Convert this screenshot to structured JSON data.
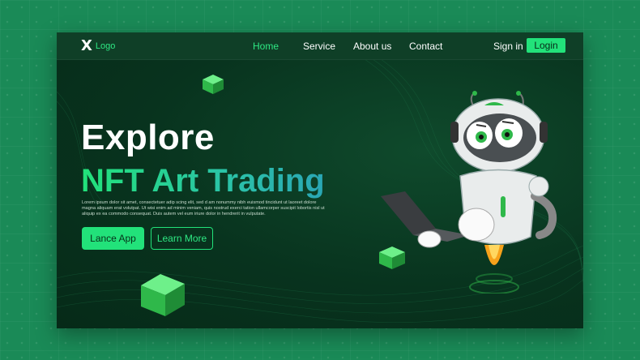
{
  "brand": {
    "logo_mark": "X",
    "logo_text": "Logo"
  },
  "nav": {
    "items": [
      {
        "label": "Home",
        "active": true
      },
      {
        "label": "Service",
        "active": false
      },
      {
        "label": "About us",
        "active": false
      },
      {
        "label": "Contact",
        "active": false
      }
    ],
    "signin_label": "Sign in",
    "login_label": "Login"
  },
  "hero": {
    "title_line1": "Explore",
    "title_line2": "NFT Art Trading",
    "description": "Lorem ipsum dolor sit amet, consectetuer adip scing elit, sed d am nonummy nibh euismod tincidunt ut laoreet dolore magna aliquam erat volutpat. Ut wisi enim ad minim veniam, quis nostrud exerci tation ullamcorper suscipit lobortis nisl ut aliquip ex ea commodo consequat. Duis autem vel eum iriure dolor in hendrerit in vulputate.",
    "primary_button": "Lance App",
    "secondary_button": "Learn More"
  },
  "colors": {
    "accent": "#22e27a",
    "background": "#1a8a57",
    "frame": "#08331e",
    "gradient_end": "#2aa6b5"
  }
}
